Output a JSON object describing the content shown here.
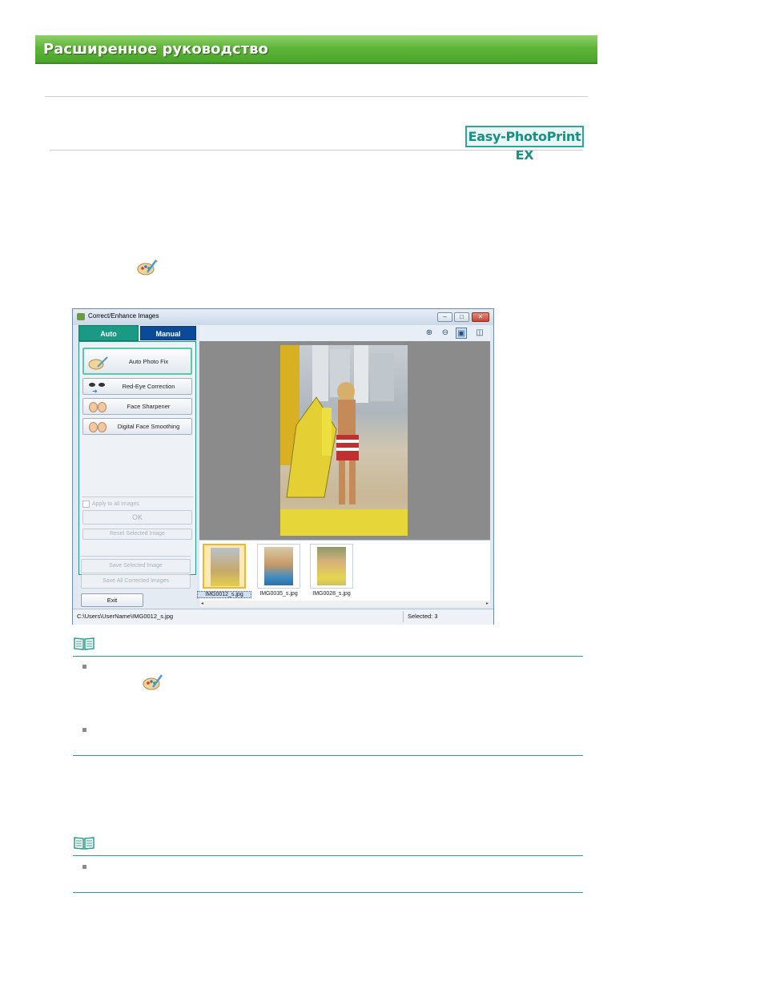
{
  "header": {
    "title": "Расширенное руководство"
  },
  "brand": {
    "label": "Easy-PhotoPrint EX"
  },
  "window": {
    "title": "Correct/Enhance Images",
    "tabs": [
      {
        "label": "Auto"
      },
      {
        "label": "Manual"
      }
    ],
    "tools": [
      {
        "label": "Auto Photo Fix"
      },
      {
        "label": "Red-Eye Correction"
      },
      {
        "label": "Face Sharpener"
      },
      {
        "label": "Digital Face Smoothing"
      }
    ],
    "apply_all_label": "Apply to all images",
    "ok_label": "OK",
    "reset_label": "Reset Selected Image",
    "save_selected_label": "Save Selected Image",
    "save_all_label": "Save All Corrected Images",
    "exit_label": "Exit",
    "thumbnails": [
      {
        "caption": "IMG0012_s.jpg"
      },
      {
        "caption": "IMG0035_s.jpg"
      },
      {
        "caption": "IMG0028_s.jpg"
      }
    ],
    "status": {
      "path": "C:\\Users\\UserName\\IMG0012_s.jpg",
      "selected": "Selected: 3"
    }
  },
  "colors": {
    "banner": "#5fb53a",
    "accent": "#2a9d8f",
    "tab_auto": "#1a9a84",
    "tab_manual": "#0b4a98"
  },
  "icons": [
    "correct-enhance-icon",
    "note-icon",
    "zoom-in-icon",
    "zoom-out-icon",
    "whole-image-icon",
    "compare-icon"
  ]
}
